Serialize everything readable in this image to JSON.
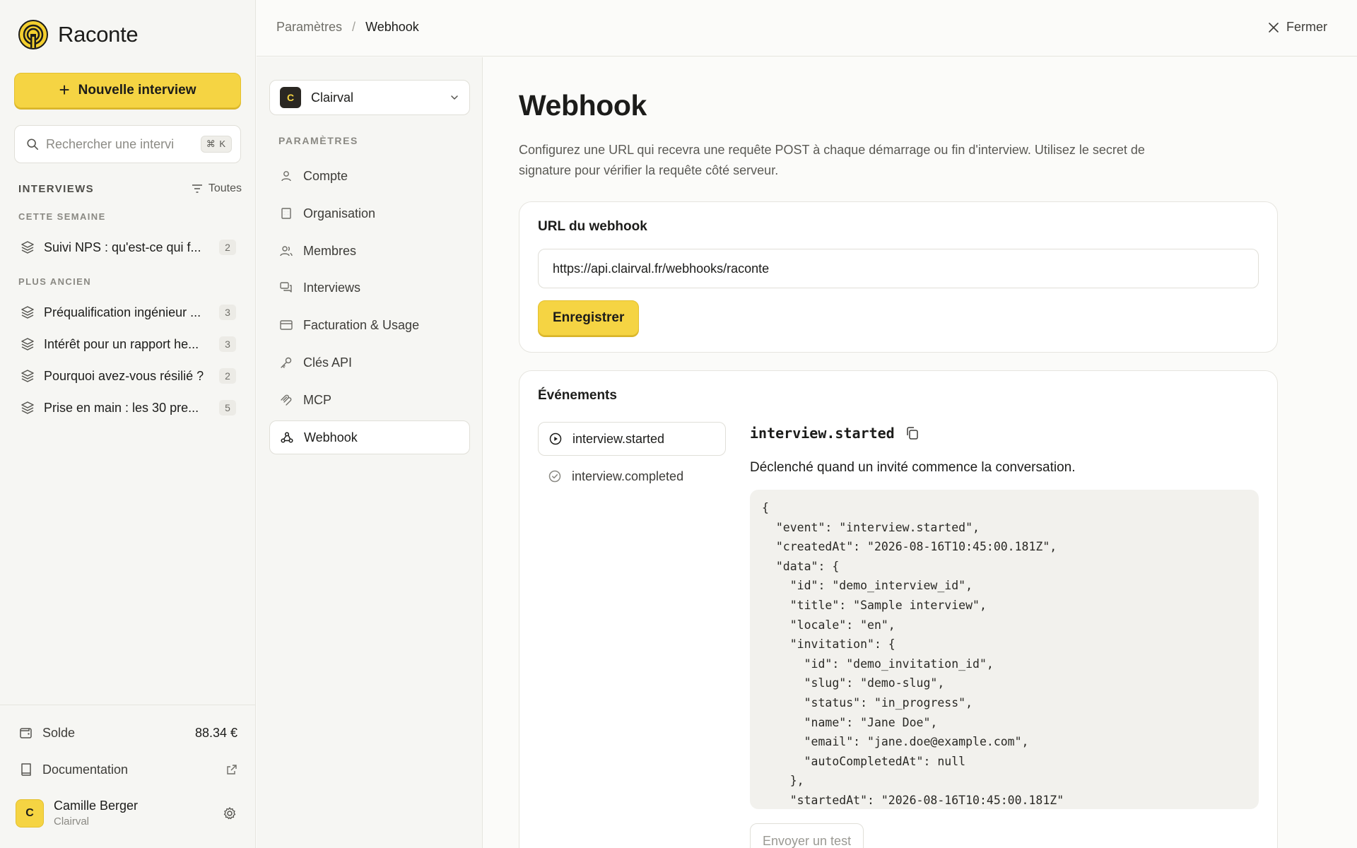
{
  "brand": {
    "name": "Raconte"
  },
  "sidebar": {
    "new_interview_label": "Nouvelle interview",
    "search_placeholder": "Rechercher une intervi",
    "search_shortcut": "⌘ K",
    "section_label": "INTERVIEWS",
    "filter_label": "Toutes",
    "groups": [
      {
        "label": "CETTE SEMAINE",
        "items": [
          {
            "title": "Suivi NPS : qu'est-ce qui f...",
            "count": "2"
          }
        ]
      },
      {
        "label": "PLUS ANCIEN",
        "items": [
          {
            "title": "Préqualification ingénieur ...",
            "count": "3"
          },
          {
            "title": "Intérêt pour un rapport he...",
            "count": "3"
          },
          {
            "title": "Pourquoi avez-vous résilié ?",
            "count": "2"
          },
          {
            "title": "Prise en main : les 30 pre...",
            "count": "5"
          }
        ]
      }
    ],
    "balance_label": "Solde",
    "balance_value": "88.34 €",
    "docs_label": "Documentation",
    "user": {
      "initial": "C",
      "name": "Camille Berger",
      "org": "Clairval"
    }
  },
  "topbar": {
    "breadcrumb": [
      "Paramètres",
      "/",
      "Webhook"
    ],
    "close_label": "Fermer"
  },
  "settings_nav": {
    "org": {
      "initial": "C",
      "name": "Clairval"
    },
    "heading": "PARAMÈTRES",
    "items": [
      {
        "label": "Compte",
        "icon": "user-icon"
      },
      {
        "label": "Organisation",
        "icon": "building-icon"
      },
      {
        "label": "Membres",
        "icon": "users-icon"
      },
      {
        "label": "Interviews",
        "icon": "chat-icon"
      },
      {
        "label": "Facturation & Usage",
        "icon": "card-icon"
      },
      {
        "label": "Clés API",
        "icon": "key-icon"
      },
      {
        "label": "MCP",
        "icon": "mcp-icon"
      },
      {
        "label": "Webhook",
        "icon": "webhook-icon"
      }
    ],
    "active": "Webhook"
  },
  "main": {
    "title": "Webhook",
    "description": "Configurez une URL qui recevra une requête POST à chaque démarrage ou fin d'interview. Utilisez le secret de signature pour vérifier la requête côté serveur.",
    "url_card": {
      "title": "URL du webhook",
      "url_value": "https://api.clairval.fr/webhooks/raconte",
      "save_label": "Enregistrer"
    },
    "events_card": {
      "title": "Événements",
      "events": [
        {
          "name": "interview.started",
          "icon": "play-circle-icon"
        },
        {
          "name": "interview.completed",
          "icon": "check-circle-icon"
        }
      ],
      "selected_event": "interview.started",
      "selected_description": "Déclenché quand un invité commence la conversation.",
      "payload": "{\n  \"event\": \"interview.started\",\n  \"createdAt\": \"2026-08-16T10:45:00.181Z\",\n  \"data\": {\n    \"id\": \"demo_interview_id\",\n    \"title\": \"Sample interview\",\n    \"locale\": \"en\",\n    \"invitation\": {\n      \"id\": \"demo_invitation_id\",\n      \"slug\": \"demo-slug\",\n      \"status\": \"in_progress\",\n      \"name\": \"Jane Doe\",\n      \"email\": \"jane.doe@example.com\",\n      \"autoCompletedAt\": null\n    },\n    \"startedAt\": \"2026-08-16T10:45:00.181Z\"",
      "test_label": "Envoyer un test"
    }
  },
  "colors": {
    "accent": "#f5d443",
    "text": "#1c1c1a",
    "muted": "#8a8983",
    "border": "#e6e5df"
  }
}
